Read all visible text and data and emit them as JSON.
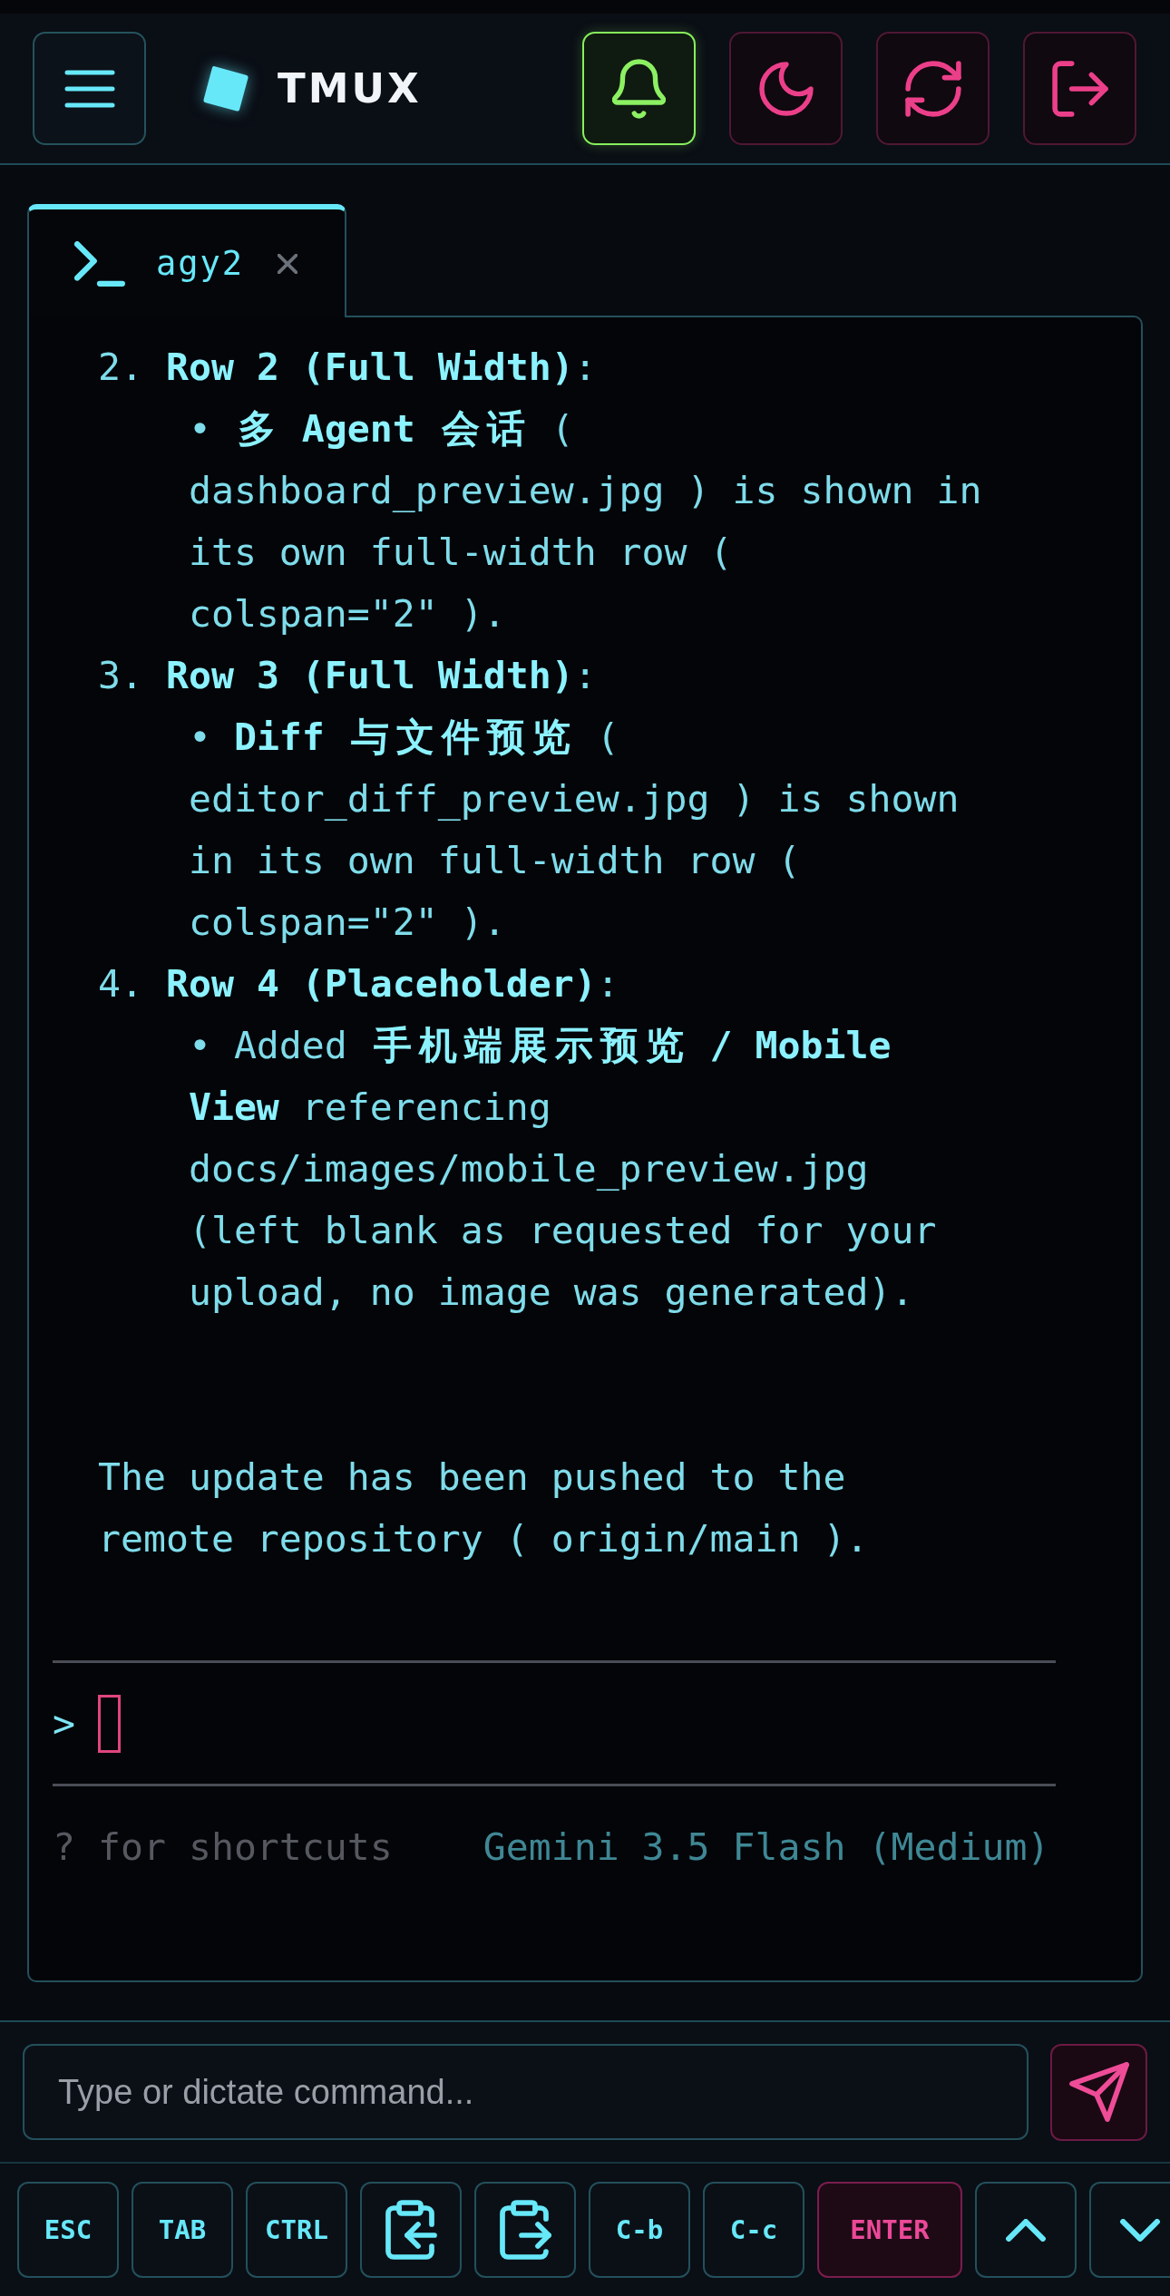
{
  "header": {
    "title": "TMUX",
    "notifications": {
      "on": true
    }
  },
  "tabs": [
    {
      "label": "agy2",
      "selected": true
    }
  ],
  "terminal": {
    "output": [
      {
        "kind": "item",
        "heading": "2. **Row 2 (Full Width)**:",
        "lines": [
          "• **多 Agent 会话** (",
          "dashboard_preview.jpg ) is shown in",
          "its own full-width row (",
          "colspan=\"2\" )."
        ]
      },
      {
        "kind": "item",
        "heading": "3. **Row 3 (Full Width)**:",
        "lines": [
          "• **Diff 与文件预览** (",
          "editor_diff_preview.jpg ) is shown",
          "in its own full-width row (",
          "colspan=\"2\" )."
        ]
      },
      {
        "kind": "item",
        "heading": "4. **Row 4 (Placeholder)**:",
        "lines": [
          "• Added **手机端展示预览 / Mobile**",
          "**View** referencing",
          "docs/images/mobile_preview.jpg",
          "(left blank as requested for your",
          "upload, no image was generated)."
        ]
      },
      {
        "kind": "paragraph",
        "lines": [
          "The update has been pushed to the",
          "remote repository ( origin/main )."
        ]
      }
    ],
    "prompt": ">",
    "footer": {
      "hint": "? for shortcuts",
      "model": "Gemini 3.5 Flash (Medium)"
    }
  },
  "command_input": {
    "placeholder": "Type or dictate command..."
  },
  "keys": [
    {
      "kind": "text",
      "label": "ESC"
    },
    {
      "kind": "text",
      "label": "TAB"
    },
    {
      "kind": "text",
      "label": "CTRL"
    },
    {
      "kind": "clipboard-in"
    },
    {
      "kind": "clipboard-out"
    },
    {
      "kind": "text",
      "label": "C-b"
    },
    {
      "kind": "text",
      "label": "C-c"
    },
    {
      "kind": "primary",
      "label": "ENTER"
    },
    {
      "kind": "up"
    },
    {
      "kind": "down"
    }
  ]
}
